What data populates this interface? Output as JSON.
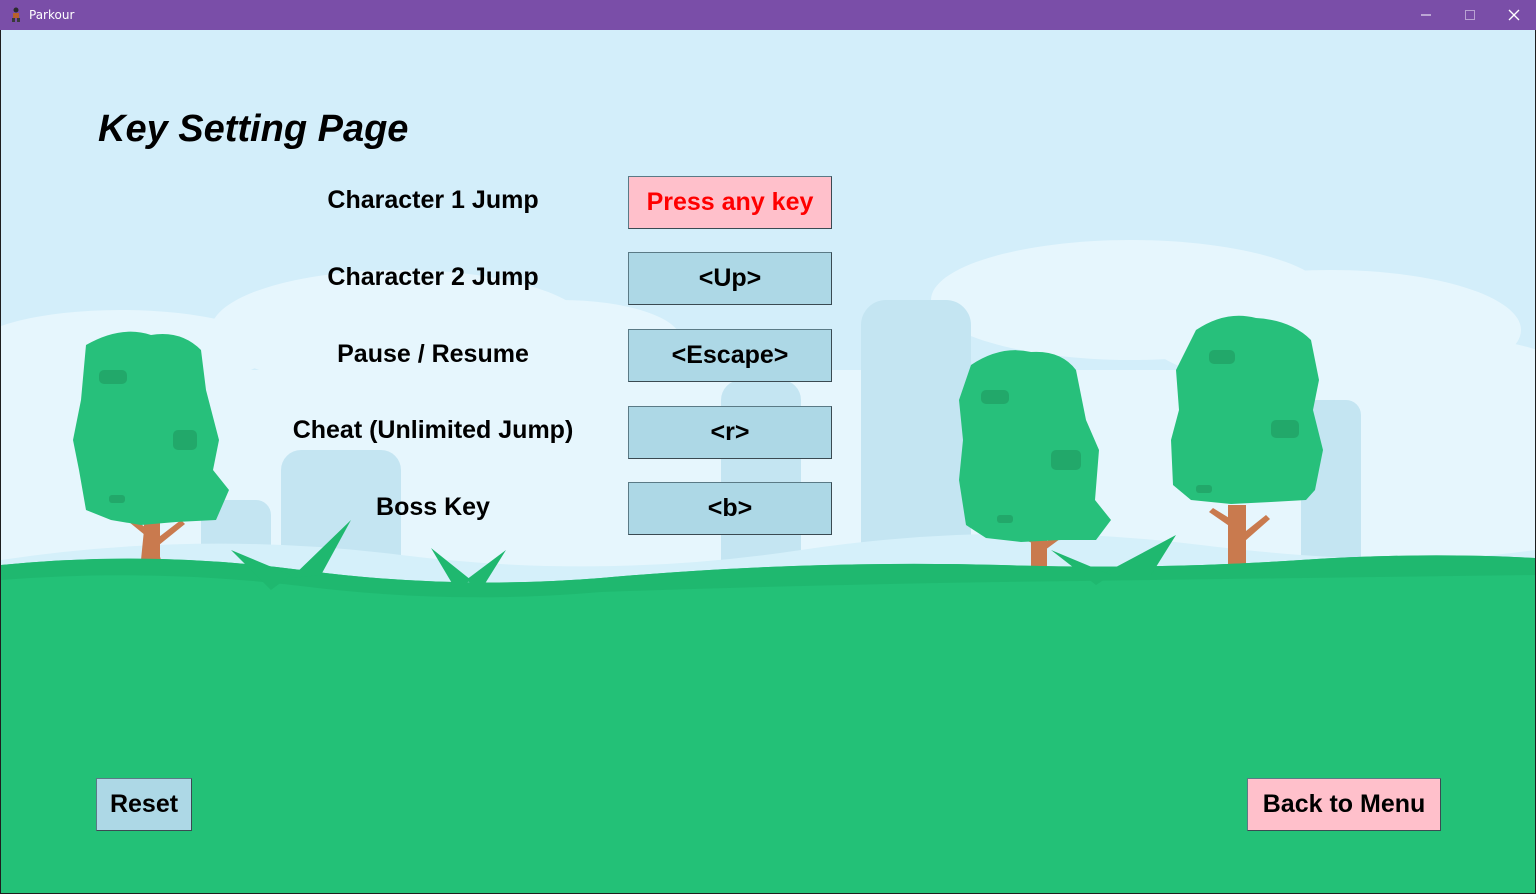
{
  "window": {
    "title": "Parkour",
    "app_icon": "parkour-character-icon",
    "controls": [
      "minimize-icon",
      "maximize-icon",
      "close-icon"
    ]
  },
  "page": {
    "title": "Key Setting Page"
  },
  "bindings": [
    {
      "label": "Character 1 Jump",
      "key": "Press any key",
      "state": "awaiting-input"
    },
    {
      "label": "Character 2 Jump",
      "key": "<Up>",
      "state": "set"
    },
    {
      "label": "Pause / Resume",
      "key": "<Escape>",
      "state": "set"
    },
    {
      "label": "Cheat (Unlimited Jump)",
      "key": "<r>",
      "state": "set"
    },
    {
      "label": "Boss Key",
      "key": "<b>",
      "state": "set"
    }
  ],
  "buttons": {
    "reset": "Reset",
    "back": "Back to Menu"
  },
  "colors": {
    "titlebar": "#7a4ea8",
    "sky": "#d3eefa",
    "grass": "#23c177",
    "key_button": "#add8e6",
    "active_button": "#ffc0cb",
    "active_text": "#ff0000"
  }
}
